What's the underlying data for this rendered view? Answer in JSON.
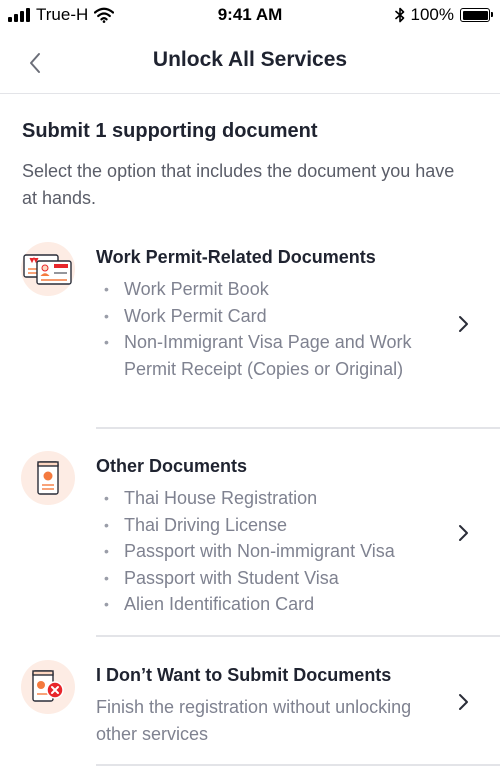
{
  "status_bar": {
    "carrier": "True-H",
    "time": "9:41 AM",
    "battery": "100%",
    "battery_level": 1.0
  },
  "nav": {
    "title": "Unlock All Services"
  },
  "section": {
    "title": "Submit 1 supporting document",
    "subtitle": "Select the option that includes the document you have at hands."
  },
  "options": [
    {
      "title": "Work Permit-Related Documents",
      "items": [
        "Work Permit Book",
        "Work Permit Card",
        "Non-Immigrant Visa Page and Work Permit Receipt (Copies or Original)"
      ]
    },
    {
      "title": "Other Documents",
      "items": [
        "Thai House Registration",
        "Thai Driving License",
        "Passport with Non-immigrant Visa",
        "Passport with Student Visa",
        "Alien Identification Card"
      ]
    },
    {
      "title": "I Don’t Want to Submit Documents",
      "description": "Finish the registration without unlocking other services"
    }
  ],
  "colors": {
    "accent": "#f47a3e",
    "icon_bg": "#fdece4",
    "danger": "#e8262b",
    "divider": "#e3e4e8"
  },
  "icons": {
    "back": "chevron-left-icon",
    "option_1": "work-permit-card-icon",
    "option_2": "passport-book-icon",
    "option_3": "document-declined-icon",
    "arrow": "chevron-right-icon"
  }
}
